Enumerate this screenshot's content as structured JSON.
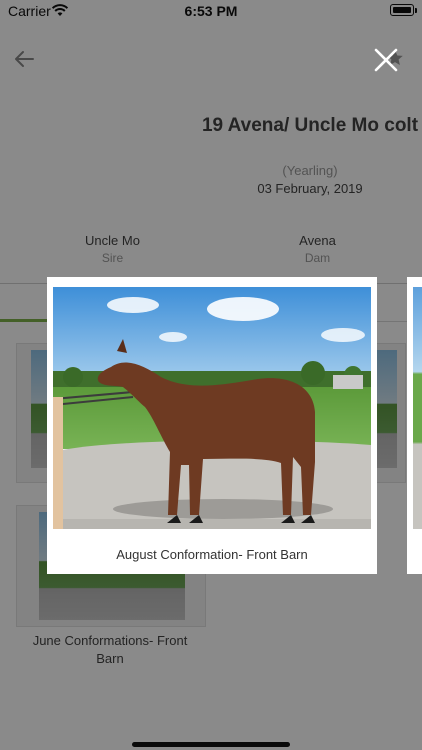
{
  "status_bar": {
    "carrier": "Carrier",
    "time": "6:53 PM"
  },
  "horse": {
    "title": "19 Avena/ Uncle Mo colt",
    "age_group": "(Yearling)",
    "date": "03 February, 2019",
    "sire_name": "Uncle Mo",
    "sire_label": "Sire",
    "dam_name": "Avena",
    "dam_label": "Dam"
  },
  "background_gallery": {
    "items": [
      {
        "label": "June Conformations- Front Barn"
      }
    ]
  },
  "photo_viewer": {
    "caption": "August Conformation- Front Barn"
  },
  "icons": {
    "back": "arrow-left-icon",
    "close": "close-icon",
    "favorite": "star-icon",
    "wifi": "wifi-icon",
    "battery": "battery-icon"
  },
  "colors": {
    "accent_green": "#7fb24a",
    "overlay": "rgba(0,0,0,0.46)"
  }
}
